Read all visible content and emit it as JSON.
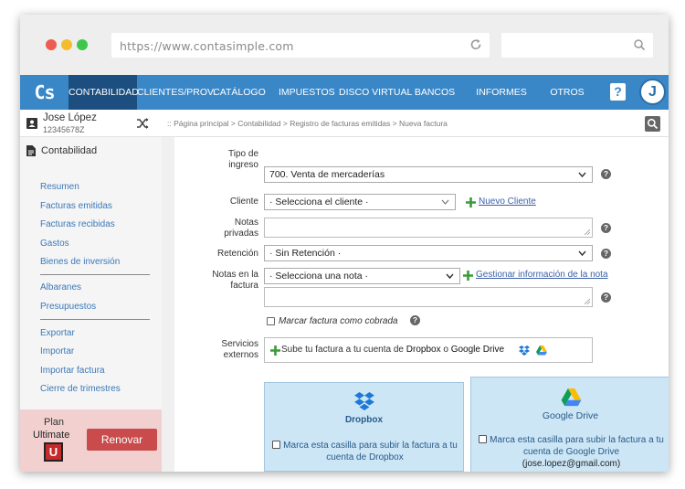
{
  "browser": {
    "url": "https://www.contasimple.com"
  },
  "nav": {
    "logo": "Cs",
    "items": [
      "CONTABILIDAD",
      "CLIENTES/PROV.",
      "CATÁLOGO",
      "IMPUESTOS",
      "DISCO VIRTUAL",
      "BANCOS",
      "INFORMES",
      "OTROS"
    ],
    "help": "?",
    "avatar_initial": "J"
  },
  "user": {
    "name": "Jose López",
    "id": "12345678Z"
  },
  "breadcrumb": ":: Página principal > Contabilidad > Registro de facturas emitidas > Nueva factura",
  "sidebar": {
    "section": "Contabilidad",
    "group1": [
      "Resumen",
      "Facturas emitidas",
      "Facturas recibidas",
      "Gastos",
      "Bienes de inversión"
    ],
    "group2": [
      "Albaranes",
      "Presupuestos"
    ],
    "group3": [
      "Exportar",
      "Importar",
      "Importar factura",
      "Cierre de trimestres"
    ]
  },
  "plan": {
    "label": "Plan",
    "name": "Ultimate",
    "badge": "U",
    "renew": "Renovar"
  },
  "form": {
    "tipo_label_1": "Tipo de",
    "tipo_label_2": "ingreso",
    "tipo_value": "700. Venta de mercaderías",
    "cliente_label": "Cliente",
    "cliente_value": "· Selecciona el cliente ·",
    "nuevo_cliente": "Nuevo Cliente",
    "notas_priv_1": "Notas",
    "notas_priv_2": "privadas",
    "retencion_label": "Retención",
    "retencion_value": "· Sin Retención ·",
    "notas_fac_1": "Notas en la",
    "notas_fac_2": "factura",
    "nota_value": "· Selecciona una nota ·",
    "gestionar_nota": "Gestionar información de la nota",
    "marcar_cobrada": "Marcar factura como cobrada",
    "servicios_1": "Servicios",
    "servicios_2": "externos",
    "svc_prefix": "Sube tu factura a tu cuenta de ",
    "svc_dropbox": "Dropbox",
    "svc_or": " o ",
    "svc_gdrive": "Google Drive",
    "help": "?"
  },
  "cards": {
    "dropbox_title": "Dropbox",
    "dropbox_text_1": "Marca esta casilla para subir la factura a tu",
    "dropbox_text_2": "cuenta de Dropbox",
    "gdrive_title": "Google Drive",
    "gdrive_text_1": "Marca esta casilla para subir la factura a tu",
    "gdrive_text_2": "cuenta de Google Drive",
    "gdrive_email": "(jose.lopez@gmail.com)"
  },
  "colors": {
    "nav": "#3a87c8",
    "nav_active": "#1c4f80",
    "link": "#3b78b8",
    "renew": "#c94b4b",
    "card": "#cce6f6"
  }
}
